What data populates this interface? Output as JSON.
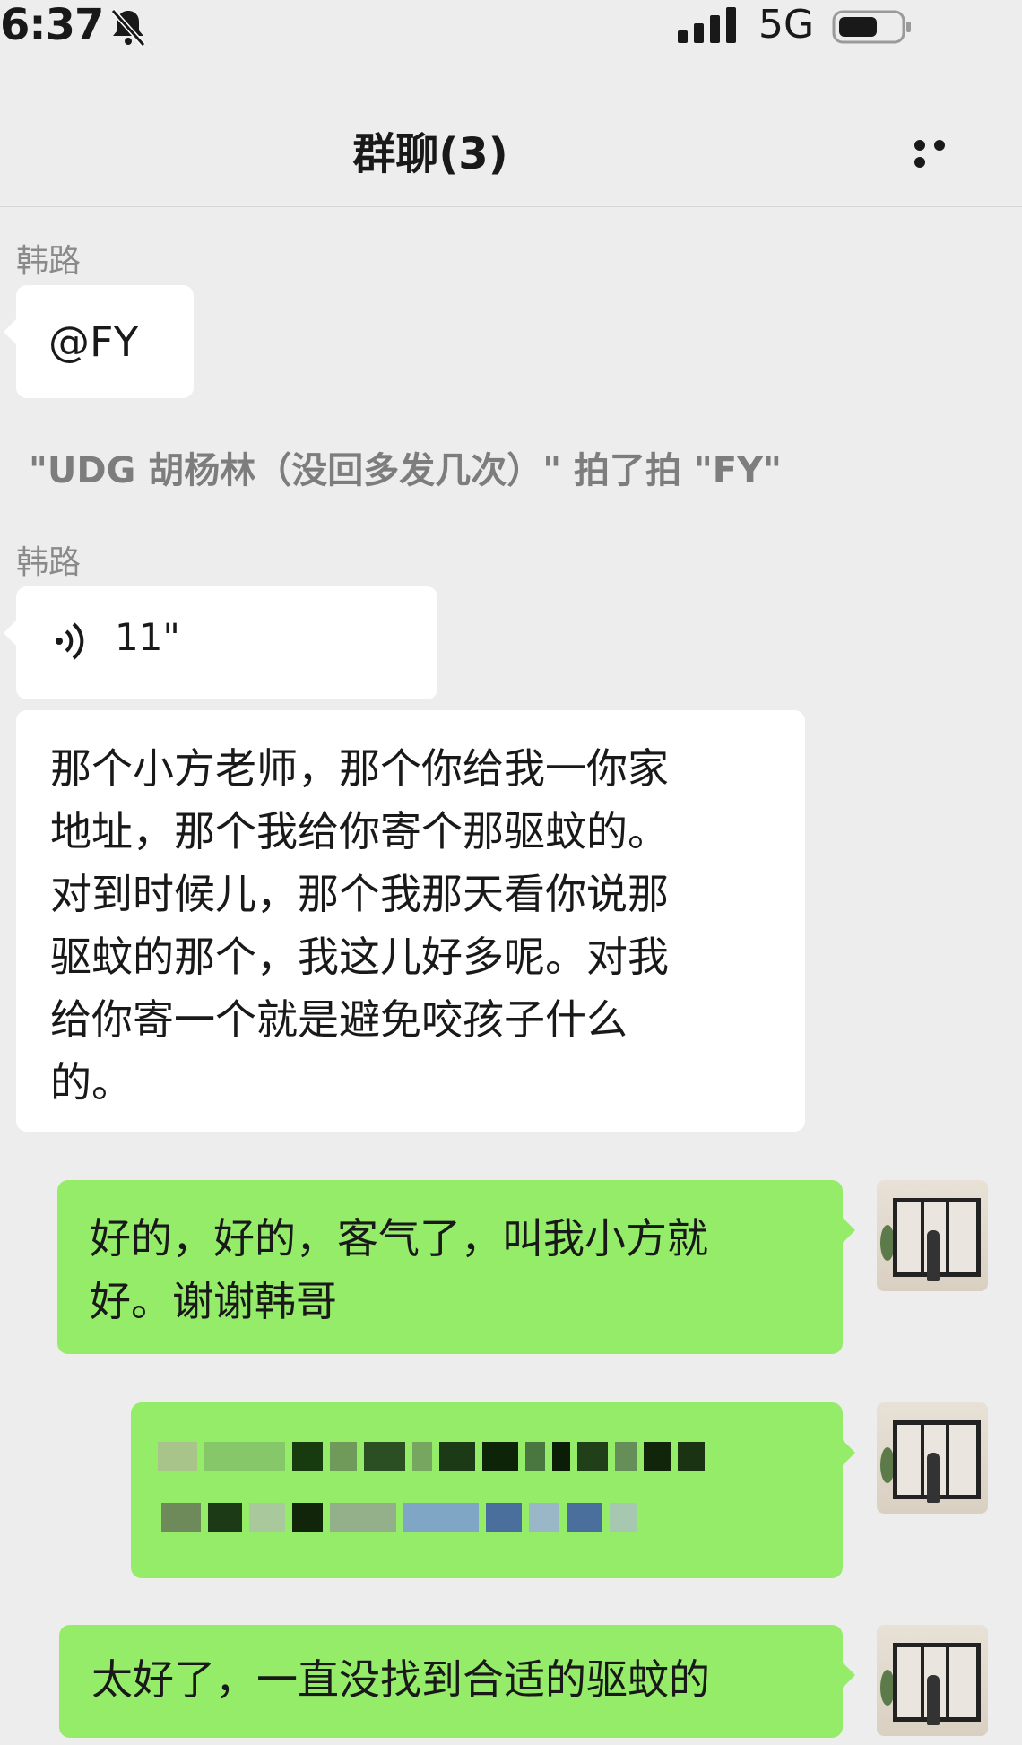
{
  "status_bar": {
    "time": "6:37",
    "network": "5G"
  },
  "header": {
    "title": "群聊(3)"
  },
  "messages": {
    "m1": {
      "sender": "韩路",
      "text": "@FY"
    },
    "system": "\"UDG 胡杨林（没回多发几次）\" 拍了拍 \"FY\"",
    "m2": {
      "sender": "韩路",
      "voice_length": "11\""
    },
    "m3": {
      "lines": [
        "那个小方老师，那个你给我一你家",
        "地址，那个我给你寄个那驱蚊的。",
        "对到时候儿，那个我那天看你说那",
        "驱蚊的那个，我这儿好多呢。对我",
        "给你寄一个就是避免咬孩子什么",
        "的。"
      ]
    },
    "m4": {
      "lines": [
        "好的，好的，客气了，叫我小方就",
        "好。谢谢韩哥"
      ]
    },
    "m6": {
      "text": "太好了，一直没找到合适的驱蚊的"
    }
  },
  "colors": {
    "outgoing_bubble": "#95ec69",
    "background": "#ededed"
  }
}
